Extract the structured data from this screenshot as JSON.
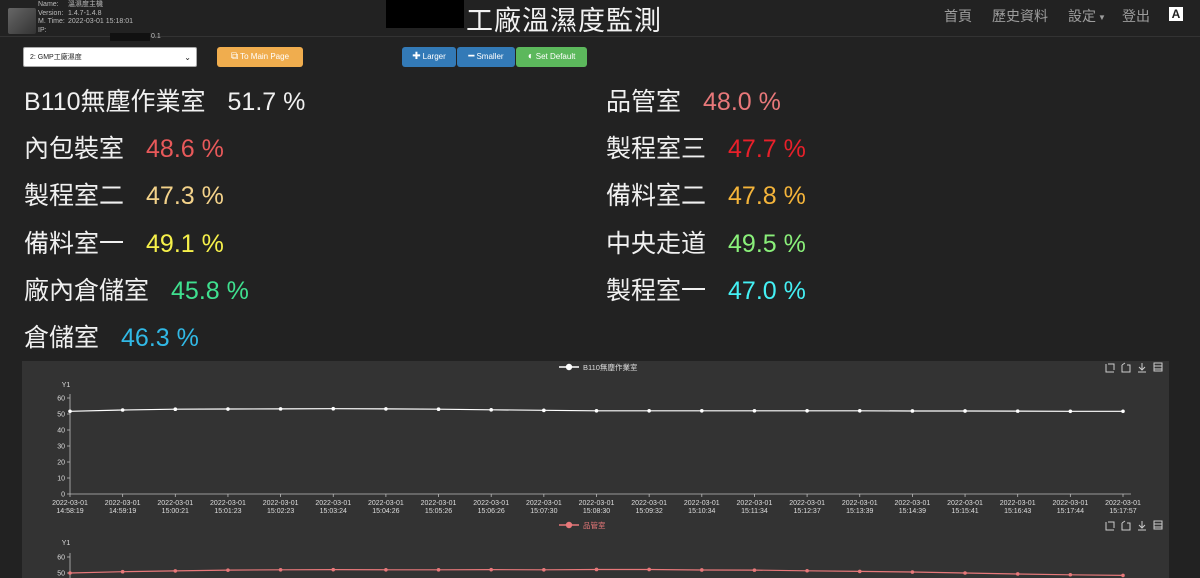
{
  "device": {
    "name_label": "Name:",
    "name": "溫濕度主機",
    "version_label": "Version:",
    "version": "1.4.7-1.4.8",
    "mtime_label": "M. Time:",
    "mtime": "2022-03-01 15:18:01",
    "ip_label": "IP:",
    "ip_tail": "0.1"
  },
  "app_title": "工廠溫濕度監測",
  "nav": {
    "home": "首頁",
    "history": "歷史資料",
    "settings": "設定",
    "logout": "登出",
    "a_icon": "A"
  },
  "controls": {
    "select_value": "2: GMP工廠濕度",
    "to_main": "To Main Page",
    "larger": "Larger",
    "smaller": "Smaller",
    "set_default": "Set Default"
  },
  "readings": {
    "left": [
      {
        "room": "B110無塵作業室",
        "value": "51.7 %",
        "color": "#f0f0f0"
      },
      {
        "room": "內包裝室",
        "value": "48.6 %",
        "color": "#e8595a"
      },
      {
        "room": "製程室二",
        "value": "47.3 %",
        "color": "#f3d28a"
      },
      {
        "room": "備料室一",
        "value": "49.1 %",
        "color": "#f6f04a"
      },
      {
        "room": "廠內倉儲室",
        "value": "45.8 %",
        "color": "#3fe08f"
      },
      {
        "room": "倉儲室",
        "value": "46.3 %",
        "color": "#31b9e6"
      }
    ],
    "right": [
      {
        "room": "品管室",
        "value": "48.0 %",
        "color": "#e8787a"
      },
      {
        "room": "製程室三",
        "value": "47.7 %",
        "color": "#e8202a"
      },
      {
        "room": "備料室二",
        "value": "47.8 %",
        "color": "#f4b43a"
      },
      {
        "room": "中央走道",
        "value": "49.5 %",
        "color": "#8af07a"
      },
      {
        "room": "製程室一",
        "value": "47.0 %",
        "color": "#44f0f4"
      }
    ]
  },
  "chart_data": [
    {
      "type": "line",
      "series": [
        {
          "name": "B110無塵作業室",
          "values": [
            51.7,
            52.5,
            53.0,
            53.1,
            53.2,
            53.3,
            53.2,
            53.0,
            52.6,
            52.3,
            52.0,
            52.0,
            52.0,
            52.0,
            52.0,
            52.0,
            51.9,
            51.9,
            51.8,
            51.7,
            51.7
          ]
        }
      ],
      "x": [
        "2022-03-01 14:58:19",
        "2022-03-01 14:59:19",
        "2022-03-01 15:00:21",
        "2022-03-01 15:01:23",
        "2022-03-01 15:02:23",
        "2022-03-01 15:03:24",
        "2022-03-01 15:04:26",
        "2022-03-01 15:05:26",
        "2022-03-01 15:06:26",
        "2022-03-01 15:07:30",
        "2022-03-01 15:08:30",
        "2022-03-01 15:09:32",
        "2022-03-01 15:10:34",
        "2022-03-01 15:11:34",
        "2022-03-01 15:12:37",
        "2022-03-01 15:13:39",
        "2022-03-01 15:14:39",
        "2022-03-01 15:15:41",
        "2022-03-01 15:16:43",
        "2022-03-01 15:17:44",
        "2022-03-01 15:17:57"
      ],
      "ylabel": "Y1",
      "yticks": [
        0,
        10,
        20,
        30,
        40,
        50,
        60
      ],
      "ylim": [
        0,
        60
      ],
      "color": "#ffffff",
      "legend": "top-center"
    },
    {
      "type": "line",
      "series": [
        {
          "name": "品管室",
          "values": [
            50.0,
            50.8,
            51.3,
            51.8,
            52.0,
            52.1,
            52.0,
            52.0,
            52.1,
            52.0,
            52.2,
            52.2,
            51.9,
            51.8,
            51.4,
            51.0,
            50.6,
            50.0,
            49.4,
            48.9,
            48.5
          ]
        }
      ],
      "ylabel": "Y1",
      "yticks": [
        50,
        60
      ],
      "ylim": [
        0,
        60
      ],
      "color": "#e8787a",
      "legend": "top-center"
    }
  ]
}
